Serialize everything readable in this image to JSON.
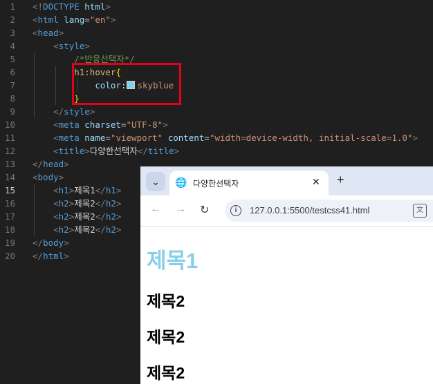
{
  "editor": {
    "lines": [
      {
        "n": "1",
        "tokens": [
          [
            "t-bracket",
            "<!"
          ],
          [
            "t-tag",
            "DOCTYPE"
          ],
          [
            "t-text",
            " "
          ],
          [
            "t-attr",
            "html"
          ],
          [
            "t-bracket",
            ">"
          ]
        ]
      },
      {
        "n": "2",
        "tokens": [
          [
            "t-bracket",
            "<"
          ],
          [
            "t-tag",
            "html"
          ],
          [
            "t-text",
            " "
          ],
          [
            "t-attr",
            "lang"
          ],
          [
            "t-text",
            "="
          ],
          [
            "t-str",
            "\"en\""
          ],
          [
            "t-bracket",
            ">"
          ]
        ]
      },
      {
        "n": "3",
        "tokens": [
          [
            "t-bracket",
            "<"
          ],
          [
            "t-tag",
            "head"
          ],
          [
            "t-bracket",
            ">"
          ]
        ]
      },
      {
        "n": "4",
        "tokens": [
          [
            "t-text",
            "    "
          ],
          [
            "t-bracket",
            "<"
          ],
          [
            "t-tag",
            "style"
          ],
          [
            "t-bracket",
            ">"
          ]
        ]
      },
      {
        "n": "5",
        "tokens": [
          [
            "t-text",
            "        "
          ],
          [
            "t-comment",
            "/*반응선택자*/"
          ]
        ]
      },
      {
        "n": "6",
        "tokens": [
          [
            "t-text",
            "        "
          ],
          [
            "t-sel",
            "h1:hover"
          ],
          [
            "t-brace",
            "{"
          ]
        ]
      },
      {
        "n": "7",
        "tokens": [
          [
            "t-text",
            "            "
          ],
          [
            "t-prop",
            "color"
          ],
          [
            "t-text",
            ":"
          ],
          [
            "swatch",
            ""
          ],
          [
            "t-val",
            "skyblue"
          ]
        ]
      },
      {
        "n": "8",
        "tokens": [
          [
            "t-text",
            "        "
          ],
          [
            "t-brace",
            "}"
          ]
        ]
      },
      {
        "n": "9",
        "tokens": [
          [
            "t-text",
            "    "
          ],
          [
            "t-bracket",
            "</"
          ],
          [
            "t-tag",
            "style"
          ],
          [
            "t-bracket",
            ">"
          ]
        ]
      },
      {
        "n": "10",
        "tokens": [
          [
            "t-text",
            "    "
          ],
          [
            "t-bracket",
            "<"
          ],
          [
            "t-tag",
            "meta"
          ],
          [
            "t-text",
            " "
          ],
          [
            "t-attr",
            "charset"
          ],
          [
            "t-text",
            "="
          ],
          [
            "t-str",
            "\"UTF-8\""
          ],
          [
            "t-bracket",
            ">"
          ]
        ]
      },
      {
        "n": "11",
        "tokens": [
          [
            "t-text",
            "    "
          ],
          [
            "t-bracket",
            "<"
          ],
          [
            "t-tag",
            "meta"
          ],
          [
            "t-text",
            " "
          ],
          [
            "t-attr",
            "name"
          ],
          [
            "t-text",
            "="
          ],
          [
            "t-str",
            "\"viewport\""
          ],
          [
            "t-text",
            " "
          ],
          [
            "t-attr",
            "content"
          ],
          [
            "t-text",
            "="
          ],
          [
            "t-str",
            "\"width=device-width, initial-scale=1.0\""
          ],
          [
            "t-bracket",
            ">"
          ]
        ]
      },
      {
        "n": "12",
        "tokens": [
          [
            "t-text",
            "    "
          ],
          [
            "t-bracket",
            "<"
          ],
          [
            "t-tag",
            "title"
          ],
          [
            "t-bracket",
            ">"
          ],
          [
            "t-text",
            "다양한선택자"
          ],
          [
            "t-bracket",
            "</"
          ],
          [
            "t-tag",
            "title"
          ],
          [
            "t-bracket",
            ">"
          ]
        ]
      },
      {
        "n": "13",
        "tokens": [
          [
            "t-bracket",
            "</"
          ],
          [
            "t-tag",
            "head"
          ],
          [
            "t-bracket",
            ">"
          ]
        ]
      },
      {
        "n": "14",
        "tokens": [
          [
            "t-bracket",
            "<"
          ],
          [
            "t-tag",
            "body"
          ],
          [
            "t-bracket",
            ">"
          ]
        ]
      },
      {
        "n": "15",
        "active": true,
        "tokens": [
          [
            "t-text",
            "    "
          ],
          [
            "t-bracket",
            "<"
          ],
          [
            "t-tag",
            "h1"
          ],
          [
            "t-bracket",
            ">"
          ],
          [
            "t-text",
            "제목1"
          ],
          [
            "t-bracket",
            "</"
          ],
          [
            "t-tag",
            "h1"
          ],
          [
            "t-bracket",
            ">"
          ]
        ]
      },
      {
        "n": "16",
        "tokens": [
          [
            "t-text",
            "    "
          ],
          [
            "t-bracket",
            "<"
          ],
          [
            "t-tag",
            "h2"
          ],
          [
            "t-bracket",
            ">"
          ],
          [
            "t-text",
            "제목2"
          ],
          [
            "t-bracket",
            "</"
          ],
          [
            "t-tag",
            "h2"
          ],
          [
            "t-bracket",
            ">"
          ]
        ]
      },
      {
        "n": "17",
        "tokens": [
          [
            "t-text",
            "    "
          ],
          [
            "t-bracket",
            "<"
          ],
          [
            "t-tag",
            "h2"
          ],
          [
            "t-bracket",
            ">"
          ],
          [
            "t-text",
            "제목2"
          ],
          [
            "t-bracket",
            "</"
          ],
          [
            "t-tag",
            "h2"
          ],
          [
            "t-bracket",
            ">"
          ]
        ]
      },
      {
        "n": "18",
        "tokens": [
          [
            "t-text",
            "    "
          ],
          [
            "t-bracket",
            "<"
          ],
          [
            "t-tag",
            "h2"
          ],
          [
            "t-bracket",
            ">"
          ],
          [
            "t-text",
            "제목2"
          ],
          [
            "t-bracket",
            "</"
          ],
          [
            "t-tag",
            "h2"
          ],
          [
            "t-bracket",
            ">"
          ]
        ]
      },
      {
        "n": "19",
        "tokens": [
          [
            "t-bracket",
            "</"
          ],
          [
            "t-tag",
            "body"
          ],
          [
            "t-bracket",
            ">"
          ]
        ]
      },
      {
        "n": "20",
        "tokens": [
          [
            "t-bracket",
            "</"
          ],
          [
            "t-tag",
            "html"
          ],
          [
            "t-bracket",
            ">"
          ]
        ]
      }
    ],
    "swatch_color": "#87ceeb",
    "highlight_color": "#e3001b"
  },
  "browser": {
    "tab_title": "다양한선택자",
    "new_tab_icon": "plus-icon",
    "url": "127.0.0.1:5500/testcss41.html",
    "page": {
      "h1": "제목1",
      "h1_color": "#87ceeb",
      "h2": [
        "제목2",
        "제목2",
        "제목2"
      ]
    }
  }
}
